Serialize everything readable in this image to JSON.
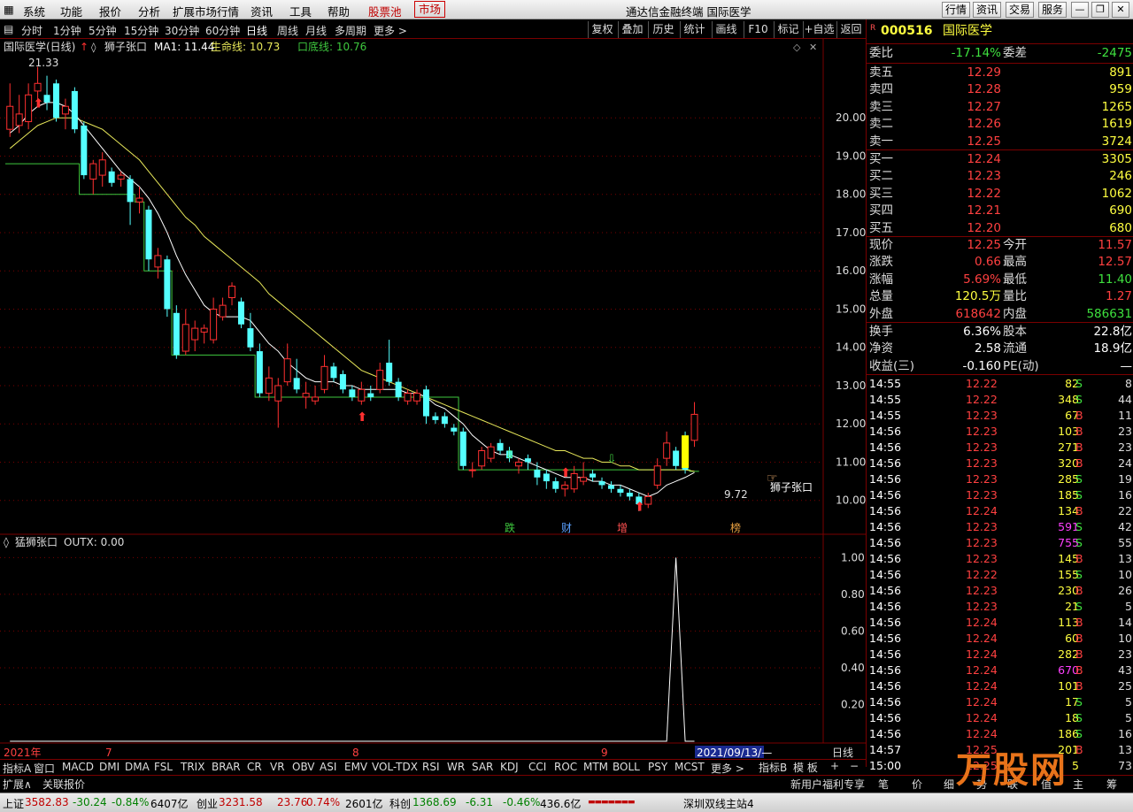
{
  "menu": {
    "items": [
      "系统",
      "功能",
      "报价",
      "分析",
      "扩展市场行情",
      "资讯",
      "工具",
      "帮助",
      "股票池",
      "市场"
    ],
    "title": "通达信金融终端 国际医学",
    "right_buttons": [
      "行情",
      "资讯",
      "交易",
      "服务"
    ]
  },
  "period_bar": {
    "items": [
      "分时",
      "1分钟",
      "5分钟",
      "15分钟",
      "30分钟",
      "60分钟",
      "日线",
      "周线",
      "月线",
      "多周期",
      "更多 >"
    ],
    "active": "日线",
    "right_buttons": [
      "复权",
      "叠加",
      "历史",
      "统计",
      "画线",
      "F10",
      "标记",
      "+自选",
      "返回"
    ]
  },
  "main_chart": {
    "stock_title": "国际医学(日线)",
    "indicator_name": "狮子张口",
    "ma1_label": "MA1: 11.44",
    "life_label": "生命线: 10.73",
    "bottom_label": "口底线: 10.76",
    "high_label": "21.33",
    "low_label": "9.72",
    "annotation": "狮子张口",
    "event_marks": [
      "跌",
      "财",
      "增",
      "榜"
    ]
  },
  "sub_chart": {
    "title": "猛狮张口",
    "value_label": "OUTX: 0.00"
  },
  "axis": {
    "date_labels": [
      "2021年",
      "7",
      "8",
      "9"
    ],
    "cursor_date": "2021/09/13/—",
    "period_label": "日线"
  },
  "chart_data": [
    {
      "type": "candlestick",
      "ylim": [
        9.3,
        21.6
      ],
      "y_ticks": [
        10.0,
        11.0,
        12.0,
        13.0,
        14.0,
        15.0,
        16.0,
        17.0,
        18.0,
        19.0,
        20.0
      ],
      "candles": [
        {
          "o": 19.7,
          "h": 20.9,
          "l": 19.5,
          "c": 20.3
        },
        {
          "o": 19.8,
          "h": 20.6,
          "l": 19.6,
          "c": 20.1
        },
        {
          "o": 19.9,
          "h": 20.9,
          "l": 19.7,
          "c": 20.6
        },
        {
          "o": 20.7,
          "h": 21.33,
          "l": 20.3,
          "c": 20.9
        },
        {
          "o": 20.6,
          "h": 21.1,
          "l": 20.2,
          "c": 20.4
        },
        {
          "o": 20.9,
          "h": 21.0,
          "l": 19.9,
          "c": 20.0
        },
        {
          "o": 20.1,
          "h": 20.5,
          "l": 19.7,
          "c": 20.3
        },
        {
          "o": 20.7,
          "h": 20.8,
          "l": 19.6,
          "c": 19.7
        },
        {
          "o": 19.8,
          "h": 19.9,
          "l": 18.4,
          "c": 18.5
        },
        {
          "o": 18.4,
          "h": 18.9,
          "l": 18.0,
          "c": 18.8
        },
        {
          "o": 18.5,
          "h": 19.1,
          "l": 18.2,
          "c": 18.9
        },
        {
          "o": 18.6,
          "h": 18.7,
          "l": 18.2,
          "c": 18.3
        },
        {
          "o": 18.4,
          "h": 18.6,
          "l": 18.2,
          "c": 18.5
        },
        {
          "o": 18.4,
          "h": 18.5,
          "l": 17.2,
          "c": 17.8
        },
        {
          "o": 17.8,
          "h": 18.2,
          "l": 17.5,
          "c": 17.9
        },
        {
          "o": 17.6,
          "h": 17.7,
          "l": 16.0,
          "c": 16.3
        },
        {
          "o": 16.1,
          "h": 16.6,
          "l": 15.8,
          "c": 16.4
        },
        {
          "o": 16.3,
          "h": 16.4,
          "l": 14.8,
          "c": 15.0
        },
        {
          "o": 14.9,
          "h": 15.1,
          "l": 13.7,
          "c": 13.8
        },
        {
          "o": 13.9,
          "h": 15.0,
          "l": 13.8,
          "c": 14.6
        },
        {
          "o": 14.2,
          "h": 14.7,
          "l": 13.9,
          "c": 14.5
        },
        {
          "o": 14.4,
          "h": 14.6,
          "l": 14.1,
          "c": 14.5
        },
        {
          "o": 14.2,
          "h": 15.3,
          "l": 14.1,
          "c": 15.0
        },
        {
          "o": 14.8,
          "h": 15.3,
          "l": 14.7,
          "c": 15.1
        },
        {
          "o": 15.3,
          "h": 15.7,
          "l": 15.1,
          "c": 15.6
        },
        {
          "o": 15.2,
          "h": 15.3,
          "l": 14.5,
          "c": 14.6
        },
        {
          "o": 14.5,
          "h": 14.9,
          "l": 13.9,
          "c": 14.0
        },
        {
          "o": 13.9,
          "h": 14.1,
          "l": 12.7,
          "c": 12.8
        },
        {
          "o": 12.8,
          "h": 13.5,
          "l": 12.6,
          "c": 13.2
        },
        {
          "o": 12.6,
          "h": 13.2,
          "l": 11.9,
          "c": 13.0
        },
        {
          "o": 13.1,
          "h": 14.1,
          "l": 13.0,
          "c": 13.7
        },
        {
          "o": 13.2,
          "h": 13.7,
          "l": 12.8,
          "c": 12.9
        },
        {
          "o": 12.7,
          "h": 13.1,
          "l": 12.4,
          "c": 12.8
        },
        {
          "o": 12.6,
          "h": 13.0,
          "l": 12.5,
          "c": 12.7
        },
        {
          "o": 12.9,
          "h": 13.8,
          "l": 12.8,
          "c": 13.5
        },
        {
          "o": 13.5,
          "h": 13.6,
          "l": 13.1,
          "c": 13.2
        },
        {
          "o": 13.3,
          "h": 13.4,
          "l": 12.8,
          "c": 12.9
        },
        {
          "o": 12.9,
          "h": 13.0,
          "l": 12.6,
          "c": 12.7
        },
        {
          "o": 12.6,
          "h": 13.1,
          "l": 12.5,
          "c": 12.9
        },
        {
          "o": 12.8,
          "h": 13.0,
          "l": 12.6,
          "c": 12.7
        },
        {
          "o": 12.9,
          "h": 13.6,
          "l": 12.8,
          "c": 13.4
        },
        {
          "o": 13.6,
          "h": 14.2,
          "l": 13.0,
          "c": 13.1
        },
        {
          "o": 13.1,
          "h": 13.2,
          "l": 12.6,
          "c": 12.7
        },
        {
          "o": 12.6,
          "h": 12.9,
          "l": 12.5,
          "c": 12.8
        },
        {
          "o": 12.6,
          "h": 12.9,
          "l": 12.5,
          "c": 12.8
        },
        {
          "o": 12.9,
          "h": 13.0,
          "l": 12.0,
          "c": 12.2
        },
        {
          "o": 12.2,
          "h": 12.3,
          "l": 12.0,
          "c": 12.1
        },
        {
          "o": 12.2,
          "h": 12.3,
          "l": 11.9,
          "c": 12.0
        },
        {
          "o": 11.9,
          "h": 12.0,
          "l": 11.7,
          "c": 11.8
        },
        {
          "o": 11.8,
          "h": 11.9,
          "l": 10.8,
          "c": 10.9
        },
        {
          "o": 10.8,
          "h": 11.0,
          "l": 10.6,
          "c": 10.8
        },
        {
          "o": 10.9,
          "h": 11.4,
          "l": 10.8,
          "c": 11.3
        },
        {
          "o": 11.1,
          "h": 11.5,
          "l": 11.0,
          "c": 11.4
        },
        {
          "o": 11.5,
          "h": 11.6,
          "l": 11.2,
          "c": 11.3
        },
        {
          "o": 11.3,
          "h": 11.4,
          "l": 11.0,
          "c": 11.1
        },
        {
          "o": 10.9,
          "h": 11.1,
          "l": 10.7,
          "c": 11.0
        },
        {
          "o": 11.1,
          "h": 11.2,
          "l": 10.8,
          "c": 11.0
        },
        {
          "o": 10.8,
          "h": 11.0,
          "l": 10.4,
          "c": 10.6
        },
        {
          "o": 10.7,
          "h": 10.8,
          "l": 10.3,
          "c": 10.5
        },
        {
          "o": 10.5,
          "h": 10.6,
          "l": 10.2,
          "c": 10.3
        },
        {
          "o": 10.3,
          "h": 10.5,
          "l": 10.1,
          "c": 10.4
        },
        {
          "o": 10.3,
          "h": 10.9,
          "l": 10.2,
          "c": 10.7
        },
        {
          "o": 10.5,
          "h": 11.0,
          "l": 10.4,
          "c": 10.6
        },
        {
          "o": 10.7,
          "h": 10.8,
          "l": 10.5,
          "c": 10.6
        },
        {
          "o": 10.5,
          "h": 10.6,
          "l": 10.3,
          "c": 10.4
        },
        {
          "o": 10.4,
          "h": 10.5,
          "l": 10.2,
          "c": 10.3
        },
        {
          "o": 10.3,
          "h": 10.4,
          "l": 10.1,
          "c": 10.2
        },
        {
          "o": 10.2,
          "h": 10.3,
          "l": 10.0,
          "c": 10.1
        },
        {
          "o": 10.1,
          "h": 10.2,
          "l": 9.72,
          "c": 9.9
        },
        {
          "o": 9.9,
          "h": 10.2,
          "l": 9.8,
          "c": 10.1
        },
        {
          "o": 10.4,
          "h": 11.1,
          "l": 10.3,
          "c": 10.9
        },
        {
          "o": 11.1,
          "h": 11.8,
          "l": 10.9,
          "c": 11.5
        },
        {
          "o": 11.3,
          "h": 11.4,
          "l": 10.8,
          "c": 10.9
        },
        {
          "o": 11.5,
          "h": 11.8,
          "l": 10.7,
          "c": 10.8
        },
        {
          "o": 11.57,
          "h": 12.57,
          "l": 11.4,
          "c": 12.25
        }
      ],
      "ma1": [
        19.6,
        19.8,
        20.1,
        20.3,
        20.4,
        20.4,
        20.3,
        20.1,
        19.8,
        19.5,
        19.2,
        18.9,
        18.6,
        18.4,
        18.2,
        17.9,
        17.5,
        17.0,
        16.4,
        15.9,
        15.5,
        15.1,
        14.9,
        14.8,
        14.8,
        14.8,
        14.7,
        14.4,
        14.1,
        13.9,
        13.6,
        13.4,
        13.2,
        13.1,
        13.1,
        13.1,
        13.0,
        13.0,
        12.9,
        12.9,
        12.9,
        12.9,
        12.9,
        12.8,
        12.8,
        12.7,
        12.5,
        12.4,
        12.2,
        12.0,
        11.7,
        11.5,
        11.3,
        11.2,
        11.2,
        11.1,
        11.0,
        10.9,
        10.8,
        10.7,
        10.6,
        10.6,
        10.6,
        10.5,
        10.5,
        10.4,
        10.4,
        10.3,
        10.2,
        10.1,
        10.2,
        10.4,
        10.5,
        10.6,
        10.73
      ],
      "life_line": [
        19.2,
        19.4,
        19.6,
        19.8,
        19.9,
        20.0,
        20.0,
        20.0,
        19.9,
        19.8,
        19.7,
        19.5,
        19.3,
        19.1,
        18.9,
        18.6,
        18.3,
        18.0,
        17.7,
        17.4,
        17.2,
        16.9,
        16.7,
        16.5,
        16.3,
        16.1,
        15.9,
        15.7,
        15.4,
        15.2,
        15.0,
        14.8,
        14.6,
        14.4,
        14.2,
        14.0,
        13.8,
        13.6,
        13.4,
        13.3,
        13.2,
        13.1,
        13.0,
        12.9,
        12.8,
        12.7,
        12.6,
        12.5,
        12.4,
        12.3,
        12.2,
        12.1,
        12.0,
        11.9,
        11.8,
        11.7,
        11.6,
        11.5,
        11.4,
        11.3,
        11.3,
        11.2,
        11.1,
        11.1,
        11.0,
        11.0,
        10.9,
        10.9,
        10.8,
        10.8,
        10.8,
        10.8,
        10.8,
        10.8,
        10.76
      ],
      "bottom_line": [
        18.8,
        18.8,
        18.8,
        18.8,
        18.8,
        18.8,
        18.8,
        18.8,
        18.0,
        18.0,
        18.0,
        18.0,
        18.0,
        18.0,
        17.8,
        16.0,
        16.0,
        16.0,
        13.8,
        13.8,
        13.8,
        13.8,
        13.8,
        13.8,
        13.8,
        13.8,
        13.8,
        12.7,
        12.7,
        12.7,
        12.7,
        12.7,
        12.7,
        12.7,
        12.7,
        12.7,
        12.7,
        12.7,
        12.7,
        12.7,
        12.7,
        12.7,
        12.7,
        12.7,
        12.7,
        12.7,
        12.7,
        12.7,
        12.7,
        10.8,
        10.8,
        10.8,
        10.8,
        10.8,
        10.8,
        10.8,
        10.8,
        10.8,
        10.8,
        10.8,
        10.8,
        10.8,
        10.8,
        10.8,
        10.8,
        10.8,
        10.8,
        10.8,
        10.8,
        10.8,
        10.8,
        10.8,
        10.8,
        10.8,
        10.76
      ]
    },
    {
      "type": "line",
      "ylim": [
        0,
        1.05
      ],
      "y_ticks": [
        "0.20",
        "0.40",
        "0.60",
        "0.80",
        "1.00"
      ],
      "series_name": "OUTX",
      "spike_index": 72,
      "values_count": 75
    }
  ],
  "quote": {
    "code": "000516",
    "name": "国际医学",
    "weibi_label": "委比",
    "weibi": "-17.14%",
    "weicha_label": "委差",
    "weicha": "-2475",
    "asks": [
      {
        "label": "卖五",
        "price": "12.29",
        "vol": "891"
      },
      {
        "label": "卖四",
        "price": "12.28",
        "vol": "959"
      },
      {
        "label": "卖三",
        "price": "12.27",
        "vol": "1265"
      },
      {
        "label": "卖二",
        "price": "12.26",
        "vol": "1619"
      },
      {
        "label": "卖一",
        "price": "12.25",
        "vol": "3724"
      }
    ],
    "bids": [
      {
        "label": "买一",
        "price": "12.24",
        "vol": "3305"
      },
      {
        "label": "买二",
        "price": "12.23",
        "vol": "246"
      },
      {
        "label": "买三",
        "price": "12.22",
        "vol": "1062"
      },
      {
        "label": "买四",
        "price": "12.21",
        "vol": "690"
      },
      {
        "label": "买五",
        "price": "12.20",
        "vol": "680"
      }
    ],
    "stats": [
      {
        "l1": "现价",
        "v1": "12.25",
        "l2": "今开",
        "v2": "11.57"
      },
      {
        "l1": "涨跌",
        "v1": "0.66",
        "l2": "最高",
        "v2": "12.57"
      },
      {
        "l1": "涨幅",
        "v1": "5.69%",
        "l2": "最低",
        "v2": "11.40"
      },
      {
        "l1": "总量",
        "v1": "120.5万",
        "l2": "量比",
        "v2": "1.27"
      },
      {
        "l1": "外盘",
        "v1": "618642",
        "l2": "内盘",
        "v2": "586631"
      }
    ],
    "fund": [
      {
        "l1": "换手",
        "v1": "6.36%",
        "l2": "股本",
        "v2": "22.8亿"
      },
      {
        "l1": "净资",
        "v1": "2.58",
        "l2": "流通",
        "v2": "18.9亿"
      },
      {
        "l1": "收益(三)",
        "v1": "-0.160",
        "l2": "PE(动)",
        "v2": "—"
      }
    ]
  },
  "ticks": [
    {
      "t": "14:55",
      "p": "12.22",
      "v": "82",
      "bs": "S",
      "n": "8"
    },
    {
      "t": "14:55",
      "p": "12.22",
      "v": "348",
      "bs": "S",
      "n": "44"
    },
    {
      "t": "14:55",
      "p": "12.23",
      "v": "67",
      "bs": "B",
      "n": "11"
    },
    {
      "t": "14:56",
      "p": "12.23",
      "v": "103",
      "bs": "B",
      "n": "23"
    },
    {
      "t": "14:56",
      "p": "12.23",
      "v": "271",
      "bs": "B",
      "n": "23"
    },
    {
      "t": "14:56",
      "p": "12.23",
      "v": "320",
      "bs": "B",
      "n": "24"
    },
    {
      "t": "14:56",
      "p": "12.23",
      "v": "285",
      "bs": "S",
      "n": "19"
    },
    {
      "t": "14:56",
      "p": "12.23",
      "v": "185",
      "bs": "S",
      "n": "16"
    },
    {
      "t": "14:56",
      "p": "12.24",
      "v": "134",
      "bs": "B",
      "n": "22"
    },
    {
      "t": "14:56",
      "p": "12.23",
      "v": "591",
      "bs": "S",
      "n": "42"
    },
    {
      "t": "14:56",
      "p": "12.23",
      "v": "755",
      "bs": "S",
      "n": "55"
    },
    {
      "t": "14:56",
      "p": "12.23",
      "v": "145",
      "bs": "B",
      "n": "13"
    },
    {
      "t": "14:56",
      "p": "12.22",
      "v": "155",
      "bs": "S",
      "n": "10"
    },
    {
      "t": "14:56",
      "p": "12.23",
      "v": "230",
      "bs": "B",
      "n": "26"
    },
    {
      "t": "14:56",
      "p": "12.23",
      "v": "21",
      "bs": "S",
      "n": "5"
    },
    {
      "t": "14:56",
      "p": "12.24",
      "v": "113",
      "bs": "B",
      "n": "14"
    },
    {
      "t": "14:56",
      "p": "12.24",
      "v": "60",
      "bs": "B",
      "n": "10"
    },
    {
      "t": "14:56",
      "p": "12.24",
      "v": "282",
      "bs": "B",
      "n": "23"
    },
    {
      "t": "14:56",
      "p": "12.24",
      "v": "670",
      "bs": "B",
      "n": "43"
    },
    {
      "t": "14:56",
      "p": "12.24",
      "v": "101",
      "bs": "B",
      "n": "25"
    },
    {
      "t": "14:56",
      "p": "12.24",
      "v": "17",
      "bs": "S",
      "n": "5"
    },
    {
      "t": "14:56",
      "p": "12.24",
      "v": "18",
      "bs": "S",
      "n": "5"
    },
    {
      "t": "14:56",
      "p": "12.24",
      "v": "186",
      "bs": "S",
      "n": "16"
    },
    {
      "t": "14:57",
      "p": "12.25",
      "v": "201",
      "bs": "B",
      "n": "13"
    },
    {
      "t": "15:00",
      "p": "12.25",
      "v": "5",
      "bs": "",
      "n": "73"
    }
  ],
  "indicator_bar": [
    "指标A",
    "窗口",
    "MACD",
    "DMI",
    "DMA",
    "FSL",
    "TRIX",
    "BRAR",
    "CR",
    "VR",
    "OBV",
    "ASI",
    "EMV",
    "VOL-TDX",
    "RSI",
    "WR",
    "SAR",
    "KDJ",
    "CCI",
    "ROC",
    "MTM",
    "BOLL",
    "PSY",
    "MCST",
    "更多 >"
  ],
  "indicator_bar_right": [
    "指标B",
    "模 板",
    "+",
    "−"
  ],
  "ext_bar": [
    "扩展∧",
    "关联报价"
  ],
  "ext_bar_right": [
    "新用户福利专享",
    "笔",
    "价",
    "细",
    "势",
    "联",
    "值",
    "主",
    "筹"
  ],
  "status": {
    "sh_label": "上证",
    "sh_val": "3582.83",
    "sh_chg": "-30.24",
    "sh_pct": "-0.84%",
    "sh_amt": "6407亿",
    "cy_label": "创业",
    "cy_val": "3231.58",
    "cy_chg": "23.76",
    "cy_pct": "0.74%",
    "cy_amt": "2601亿",
    "kc_label": "科创",
    "kc_val": "1368.69",
    "kc_chg": "-6.31",
    "kc_pct": "-0.46%",
    "kc_amt": "436.6亿",
    "server": "深圳双线主站4"
  },
  "watermark": "万股网",
  "colors": {
    "up": "#ff3030",
    "down": "#54ffff",
    "ma": "#ffffff",
    "life": "#e8e85a",
    "bottom": "#3ec83e",
    "grid": "#7a0000"
  }
}
